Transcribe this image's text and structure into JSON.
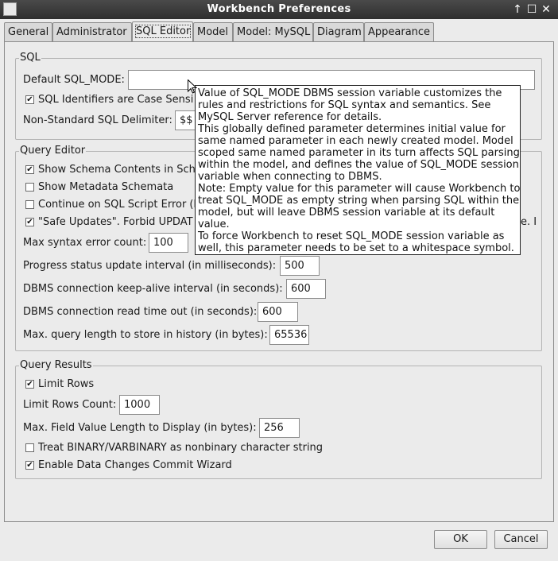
{
  "window": {
    "title": "Workbench Preferences",
    "controls": [
      "↑",
      "☐",
      "✕"
    ]
  },
  "tabs": [
    {
      "label": "General",
      "active": false
    },
    {
      "label": "Administrator",
      "active": false
    },
    {
      "label": "SQL Editor",
      "active": true
    },
    {
      "label": "Model",
      "active": false
    },
    {
      "label": "Model: MySQL",
      "active": false
    },
    {
      "label": "Diagram",
      "active": false
    },
    {
      "label": "Appearance",
      "active": false
    }
  ],
  "sql_group": {
    "title": "SQL",
    "default_sql_mode_label": "Default SQL_MODE:",
    "default_sql_mode_value": "",
    "case_sensitive_label": "SQL Identifiers are Case Sensi",
    "case_sensitive_checked": true,
    "delimiter_label": "Non-Standard SQL Delimiter:",
    "delimiter_value": "$$"
  },
  "query_editor": {
    "title": "Query Editor",
    "show_schema_label": "Show Schema Contents in Sch",
    "show_schema_checked": true,
    "show_metadata_label": "Show Metadata Schemata",
    "show_metadata_checked": false,
    "continue_on_error_label": "Continue on SQL Script Error (b",
    "continue_on_error_checked": false,
    "safe_updates_label": "\"Safe Updates\". Forbid UPDAT",
    "safe_updates_tail": "e. I",
    "safe_updates_checked": true,
    "max_syntax_label": "Max syntax error count:",
    "max_syntax_value": "100",
    "progress_label": "Progress status update interval (in milliseconds):",
    "progress_value": "500",
    "keepalive_label": "DBMS connection keep-alive interval (in seconds):",
    "keepalive_value": "600",
    "read_timeout_label": "DBMS connection read time out (in seconds):",
    "read_timeout_value": "600",
    "max_query_label": "Max. query length to store in history (in bytes):",
    "max_query_value": "65536"
  },
  "query_results": {
    "title": "Query Results",
    "limit_rows_label": "Limit Rows",
    "limit_rows_checked": true,
    "limit_rows_count_label": "Limit Rows Count:",
    "limit_rows_count_value": "1000",
    "max_field_label": "Max. Field Value Length to Display (in bytes):",
    "max_field_value": "256",
    "binary_label": "Treat BINARY/VARBINARY as nonbinary character string",
    "binary_checked": false,
    "commit_wizard_label": "Enable Data Changes Commit Wizard",
    "commit_wizard_checked": true
  },
  "tooltip": {
    "lines": [
      "Value of SQL_MODE DBMS session variable customizes the",
      "rules and restrictions for SQL syntax and semantics. See",
      "MySQL Server reference for details.",
      "This globally defined parameter determines initial value for",
      "same named parameter in each newly created model. Model",
      "scoped same named parameter in its turn affects SQL parsing",
      "within the model, and defines the value of SQL_MODE session",
      "variable when connecting to DBMS.",
      "Note: Empty value for this parameter will cause Workbench to",
      "treat SQL_MODE as empty string when parsing SQL within the",
      "model, but will leave DBMS session variable at its default",
      "value.",
      "To force Workbench to reset SQL_MODE session variable as",
      "well, this parameter needs to be set to a whitespace symbol."
    ]
  },
  "buttons": {
    "ok": "OK",
    "cancel": "Cancel"
  }
}
